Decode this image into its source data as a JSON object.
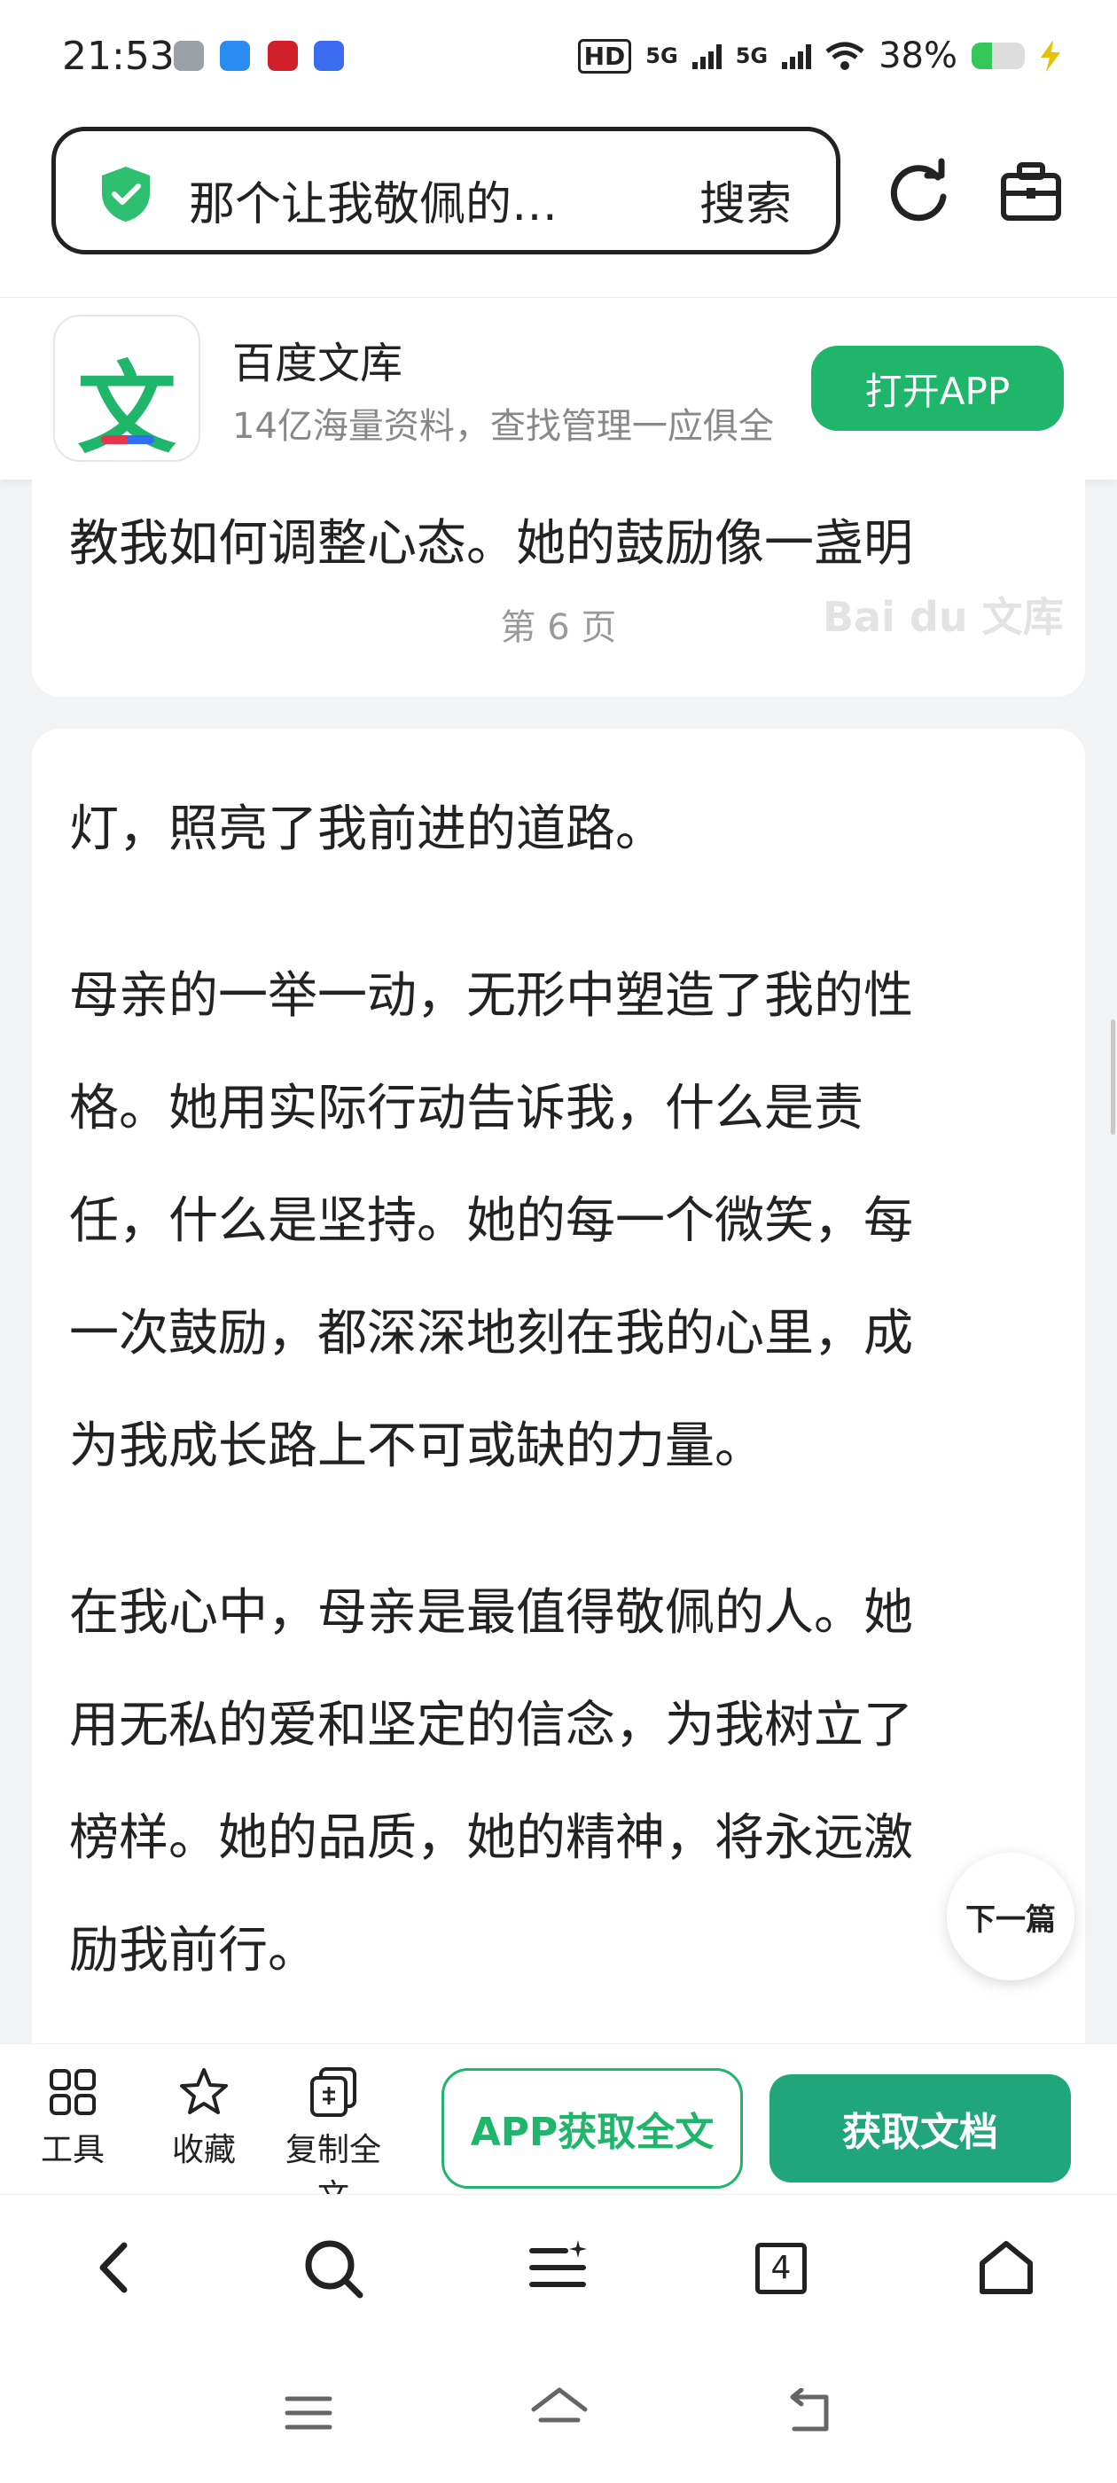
{
  "status_bar": {
    "time": "21:53",
    "network_1": "5G",
    "network_2": "5G",
    "hd_label": "HD",
    "battery": "38%",
    "battery_level": 0.38,
    "accent_battery": "#35c759"
  },
  "browser": {
    "address_text": "那个让我敬佩的…",
    "search_label": "搜索",
    "tabs_count": "4"
  },
  "app_banner": {
    "icon_glyph": "文",
    "name": "百度文库",
    "description": "14亿海量资料，查找管理一应俱全",
    "open_button": "打开APP"
  },
  "document": {
    "page6_last_line": "教我如何调整心态。她的鼓励像一盏明",
    "page6_label": "第 6 页",
    "watermark": "Bai du 文库",
    "page7_lines": [
      "灯，照亮了我前进的道路。",
      "  母亲的一举一动，无形中塑造了我的性",
      "格。她用实际行动告诉我，什么是责",
      "任，什么是坚持。她的每一个微笑，每",
      "一次鼓励，都深深地刻在我的心里，成",
      "为我成长路上不可或缺的力量。",
      "  在我心中，母亲是最值得敬佩的人。她",
      "用无私的爱和坚定的信念，为我树立了",
      "榜样。她的品质，她的精神，将永远激",
      "励我前行。"
    ],
    "next_article": "下一篇"
  },
  "toolbar": {
    "tools_label": "工具",
    "favorite_label": "收藏",
    "copy_label": "复制全文",
    "app_fulltext": "APP获取全文",
    "get_document": "获取文档",
    "accent_green": "#1fb56b",
    "accent_teal": "#20a67a"
  }
}
